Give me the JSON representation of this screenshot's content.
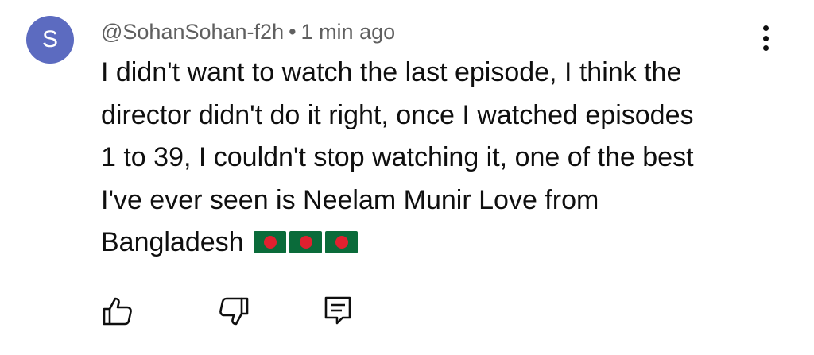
{
  "comment": {
    "avatar_letter": "S",
    "avatar_color": "#5c6bc0",
    "author": "@SohanSohan-f2h",
    "separator": "•",
    "timestamp": "1 min ago",
    "text_lines": [
      "I didn't want to watch the last episode, I think the",
      "director didn't do it right, once I watched episodes",
      "1 to 39, I couldn't stop watching it, one of the best",
      "I've ever seen is Neelam Munir Love from",
      "Bangladesh"
    ],
    "emojis": [
      "bangladesh-flag",
      "bangladesh-flag",
      "bangladesh-flag"
    ]
  },
  "actions": {
    "like_icon": "thumb-up-icon",
    "dislike_icon": "thumb-down-icon",
    "reply_icon": "comment-reply-icon",
    "menu_icon": "more-vert-icon"
  }
}
